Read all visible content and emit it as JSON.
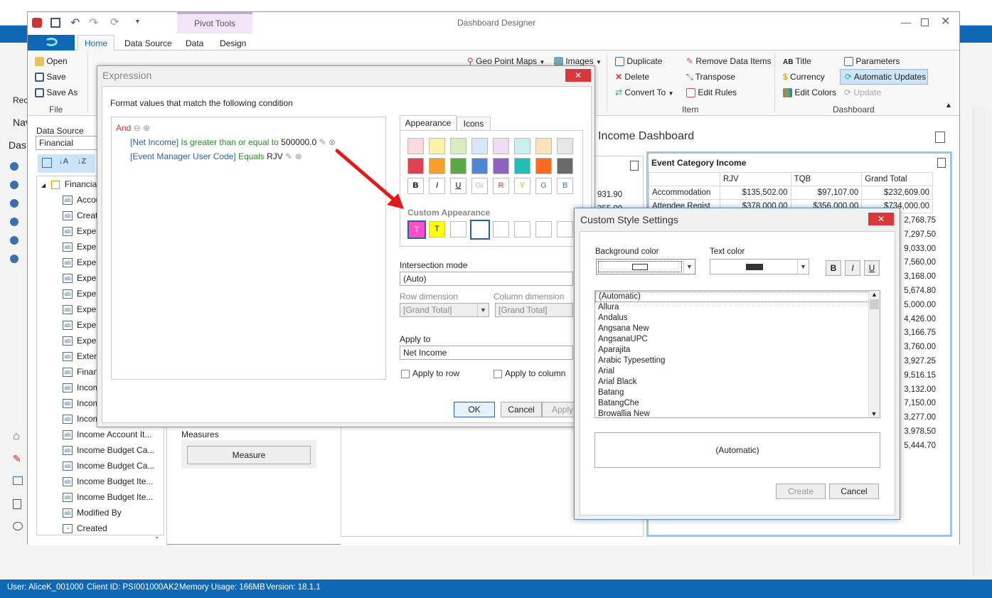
{
  "window": {
    "title": "Dashboard Designer",
    "contextual_group": "Pivot Tools"
  },
  "ribbon": {
    "tabs": [
      "Home",
      "Data Source",
      "Data",
      "Design"
    ],
    "file_group": {
      "label": "File",
      "open": "Open",
      "save": "Save",
      "save_as": "Save As"
    },
    "insert_items": {
      "geo_point_maps": "Geo Point Maps",
      "images": "Images"
    },
    "item_group": {
      "label": "Item",
      "duplicate": "Duplicate",
      "delete": "Delete",
      "convert_to": "Convert To",
      "remove_data_items": "Remove Data Items",
      "transpose": "Transpose",
      "edit_rules": "Edit Rules"
    },
    "dashboard_group": {
      "label": "Dashboard",
      "title": "Title",
      "currency": "Currency",
      "edit_colors": "Edit Colors",
      "parameters": "Parameters",
      "automatic_updates": "Automatic Updates",
      "update": "Update"
    }
  },
  "left_panel": {
    "nav_label": "Nav",
    "das_label": "Das",
    "rec_label": "Rec"
  },
  "data_source": {
    "label": "Data Source",
    "value": "Financial",
    "root": "Financial",
    "fields": [
      "Accou",
      "Creat",
      "Exper",
      "Exper",
      "Exper",
      "Exper",
      "Exper",
      "Exper",
      "Exper",
      "Exper",
      "Exter",
      "Finan",
      "Incom",
      "Incom",
      "Incom",
      "Income Account It...",
      "Income Budget Ca...",
      "Income Budget Ca...",
      "Income Budget Ite...",
      "Income Budget Ite...",
      "Modified By",
      "Created"
    ]
  },
  "measures": {
    "label": "Measures",
    "button": "Measure"
  },
  "dashboard": {
    "title": "Income Dashboard",
    "partial_values": [
      "931.90",
      "355.00"
    ],
    "event_table": {
      "title": "Event Category Income",
      "headers": [
        "",
        "RJV",
        "TQB",
        "Grand Total"
      ],
      "rows": [
        [
          "Accommodation",
          "$135,502.00",
          "$97,107.00",
          "$232,609.00"
        ],
        [
          "Attendee Regist",
          "$378,000.00",
          "$356,000.00",
          "$734,000.00"
        ]
      ],
      "grand_totals_visible": [
        "2,768.75",
        "7,297.50",
        "9,033.00",
        "7,560.00",
        "3,168.00",
        "5,674.80",
        "5,000.00",
        "4,426.00",
        "3,166.75",
        "3,760.00",
        "3,927.25",
        "9,516.15",
        "3,132.00",
        "7,150.00",
        "3,277.00",
        "3,978.50",
        "5,444.70"
      ]
    }
  },
  "expression_dialog": {
    "title": "Expression",
    "prompt": "Format values that match the following condition",
    "and": "And",
    "conditions": [
      {
        "field": "[Net Income]",
        "op": "Is greater than or equal to",
        "value": "500000.0"
      },
      {
        "field": "[Event Manager User Code]",
        "op": "Equals",
        "value": "RJV"
      }
    ],
    "tabs": [
      "Appearance",
      "Icons"
    ],
    "font_buttons": [
      "B",
      "I",
      "U",
      "Gr",
      "R",
      "Y",
      "G",
      "B"
    ],
    "custom_appearance_label": "Custom Appearance",
    "custom_swatches": [
      "T",
      "T"
    ],
    "intersection_mode": {
      "label": "Intersection mode",
      "value": "(Auto)"
    },
    "row_dimension": {
      "label": "Row dimension",
      "value": "[Grand Total]"
    },
    "column_dimension": {
      "label": "Column dimension",
      "value": "[Grand Total]"
    },
    "apply_to": {
      "label": "Apply to",
      "value": "Net Income"
    },
    "apply_to_row": "Apply to row",
    "apply_to_column": "Apply to column",
    "ok": "OK",
    "cancel": "Cancel",
    "apply": "Apply"
  },
  "custom_style_dialog": {
    "title": "Custom Style Settings",
    "background_color_label": "Background color",
    "text_color_label": "Text color",
    "style_buttons": [
      "B",
      "I",
      "U"
    ],
    "fonts": [
      "(Automatic)",
      "Allura",
      "Andalus",
      "Angsana New",
      "AngsanaUPC",
      "Aparajita",
      "Arabic Typesetting",
      "Arial",
      "Arial Black",
      "Batang",
      "BatangChe",
      "Browallia New"
    ],
    "preview": "(Automatic)",
    "create": "Create",
    "cancel": "Cancel"
  },
  "status_bar": {
    "user": "User: AliceK_001000",
    "client": "Client ID: PSI001000AK2",
    "memory": "Memory Usage: 166MB",
    "version": "Version: 18.1.1"
  },
  "colors": {
    "accent": "#0e68b3",
    "close_red": "#d9383a",
    "highlight": "#cce4f7"
  }
}
